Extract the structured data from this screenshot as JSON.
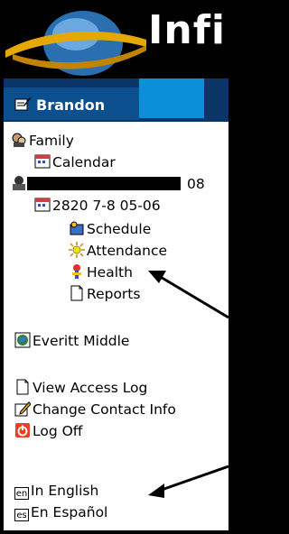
{
  "header": {
    "logo_text": "Infi"
  },
  "user": {
    "name": "Brandon"
  },
  "nav": {
    "family": "Family",
    "calendar": "Calendar",
    "redacted_suffix": "08",
    "section": "2820 7-8 05-06",
    "schedule": "Schedule",
    "attendance": "Attendance",
    "health": "Health",
    "reports": "Reports",
    "school": "Everitt Middle",
    "view_access_log": "View Access Log",
    "change_contact_info": "Change Contact Info",
    "log_off": "Log Off",
    "english": "In English",
    "espanol": "En Español",
    "lang_en": "en",
    "lang_es": "es"
  }
}
